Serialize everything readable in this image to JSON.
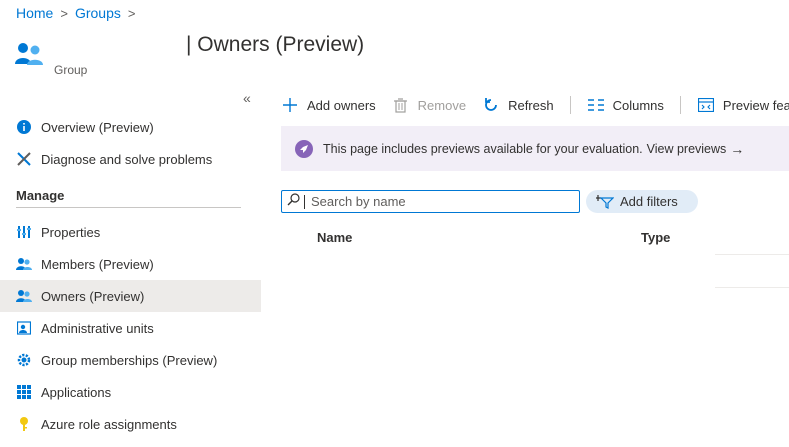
{
  "breadcrumb": {
    "items": [
      "Home",
      "Groups"
    ],
    "separator": ">"
  },
  "header": {
    "title": "| Owners (Preview)",
    "subtitle": "Group",
    "icon": "group-icon"
  },
  "sidebar": {
    "collapse_label": "«",
    "items_top": [
      {
        "label": "Overview (Preview)",
        "icon": "info-icon"
      },
      {
        "label": "Diagnose and solve problems",
        "icon": "wrench-icon"
      }
    ],
    "section_label": "Manage",
    "items_manage": [
      {
        "label": "Properties",
        "icon": "properties-icon"
      },
      {
        "label": "Members (Preview)",
        "icon": "members-icon"
      },
      {
        "label": "Owners (Preview)",
        "icon": "owners-icon",
        "active": true
      },
      {
        "label": "Administrative units",
        "icon": "admin-units-icon"
      },
      {
        "label": "Group memberships (Preview)",
        "icon": "gear-icon"
      },
      {
        "label": "Applications",
        "icon": "grid-icon"
      },
      {
        "label": "Azure role assignments",
        "icon": "key-icon"
      }
    ]
  },
  "toolbar": {
    "add_owners": "Add owners",
    "remove": "Remove",
    "refresh": "Refresh",
    "columns": "Columns",
    "preview_features": "Preview featu"
  },
  "banner": {
    "text": "This page includes previews available for your evaluation.",
    "link": "View previews",
    "arrow": "→"
  },
  "search": {
    "placeholder": "Search by name",
    "value": ""
  },
  "filters": {
    "add_label": "Add filters"
  },
  "table": {
    "columns": [
      "Name",
      "Type"
    ]
  },
  "colors": {
    "accent": "#0078d4",
    "banner_bg": "#f2eef7",
    "banner_icon": "#8764b8",
    "active_nav": "#edebe9"
  }
}
